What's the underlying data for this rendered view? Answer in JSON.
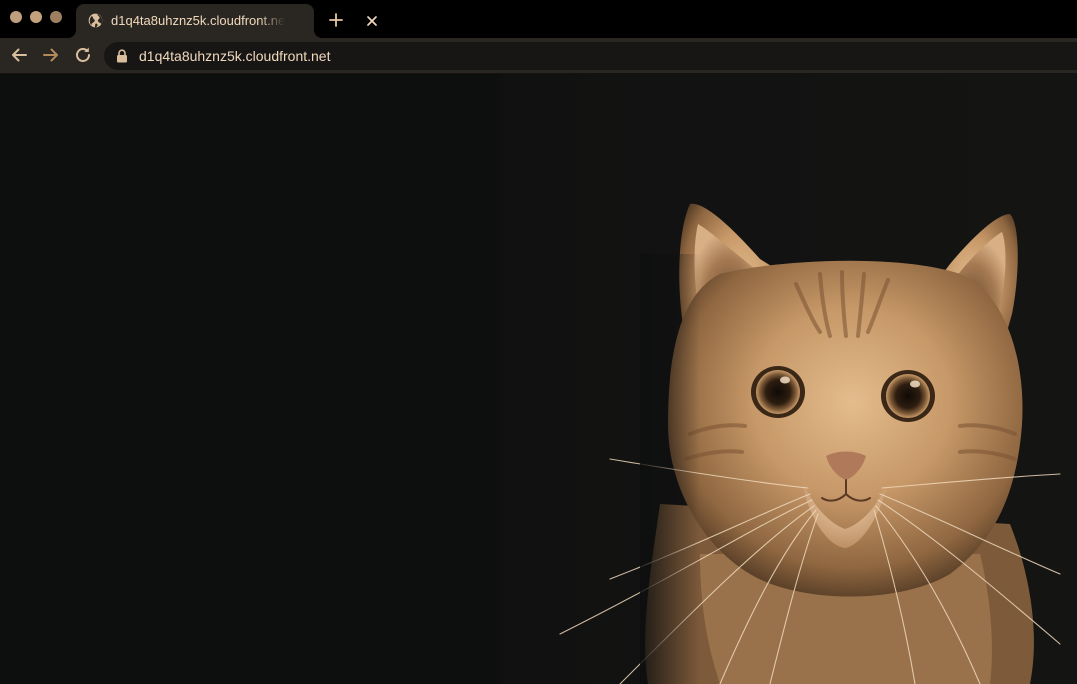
{
  "browser": {
    "tab": {
      "title": "d1q4ta8uhznz5k.cloudfront.net",
      "favicon": "globe-icon",
      "close_icon": "close-icon"
    },
    "new_tab_icon": "plus-icon",
    "toolbar": {
      "back_icon": "arrow-left-icon",
      "forward_icon": "arrow-right-icon",
      "reload_icon": "reload-icon",
      "lock_icon": "lock-icon",
      "url": "d1q4ta8uhznz5k.cloudfront.net"
    }
  },
  "page": {
    "hero_image": "orange-tabby-cat-portrait"
  },
  "colors": {
    "accent": "#e9c8a0",
    "tab_text": "#f0d9bd",
    "icon": "#d9bf9e",
    "forward_disabled": "#b58a5a",
    "traffic_close": "#bf9f7d",
    "traffic_minimize": "#c4a27d",
    "traffic_zoom": "#9e7f60",
    "toolbar_bg": "#2a2722",
    "omnibox_bg": "#171614",
    "page_bg": "#0d0e0e",
    "cat_fur": "#c99a68"
  }
}
